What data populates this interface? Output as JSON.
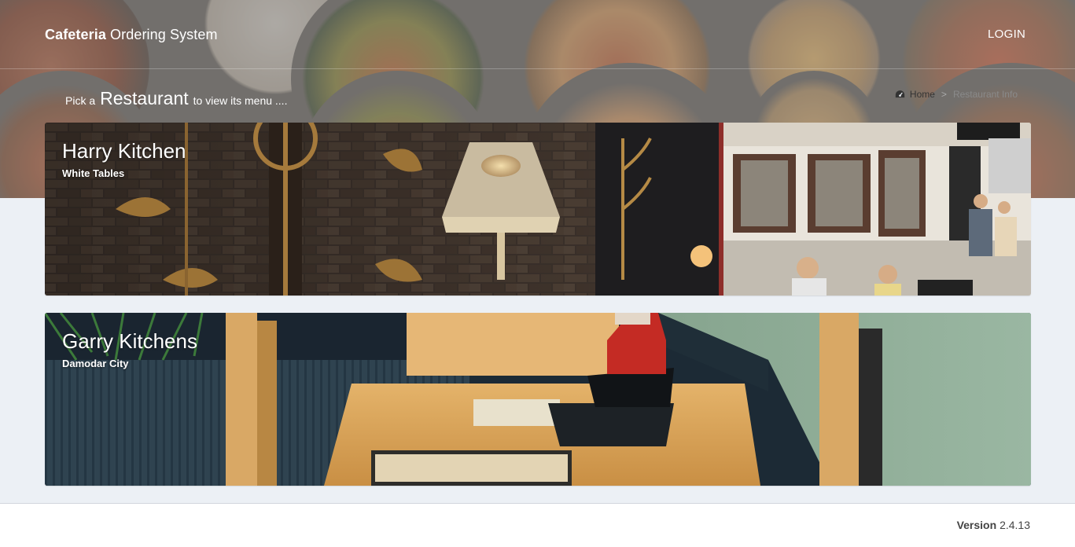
{
  "navbar": {
    "brand_bold": "Cafeteria",
    "brand_rest": " Ordering System",
    "login_label": "LOGIN"
  },
  "header": {
    "pick_prefix": "Pick a",
    "pick_highlight": "Restaurant",
    "pick_suffix": "to view its menu ....",
    "breadcrumb": {
      "home_icon": "dashboard-icon",
      "home_label": "Home",
      "separator": ">",
      "current_label": "Restaurant Info"
    }
  },
  "restaurants": [
    {
      "name": "Harry Kitchen",
      "location": "White Tables"
    },
    {
      "name": "Garry Kitchens",
      "location": "Damodar City"
    }
  ],
  "footer": {
    "version_label": "Version",
    "version_number": "2.4.13"
  },
  "colors": {
    "page_bg": "#ecf0f5",
    "footer_bg": "#ffffff",
    "header_text": "#ffffff"
  }
}
